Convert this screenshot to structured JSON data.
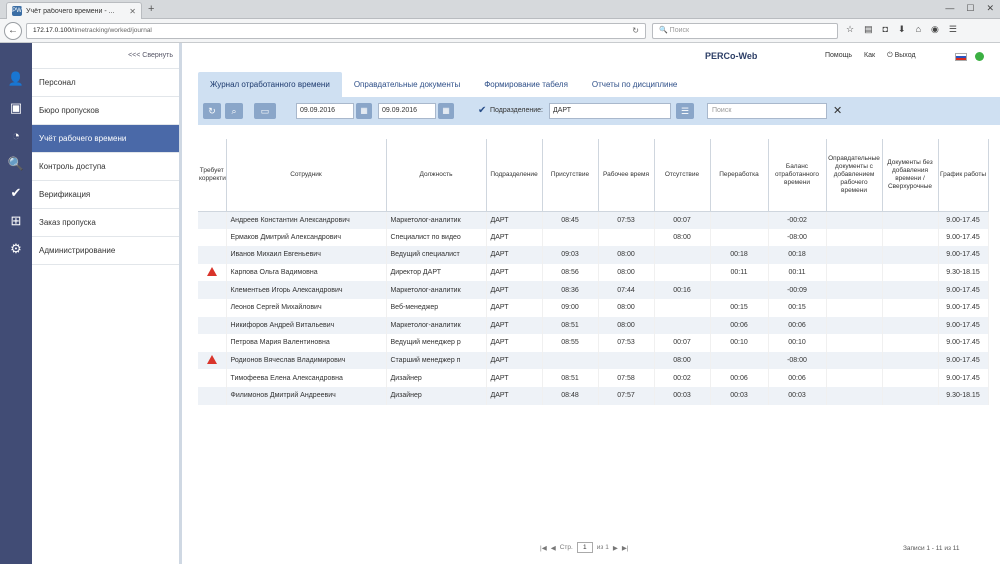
{
  "browser": {
    "tab_title": "Учёт рабочего времени - ...",
    "tab_favicon": "PW",
    "url_host": "172.17.0.100",
    "url_path": "/timetracking/worked/journal",
    "search_placeholder": "Поиск"
  },
  "side_menu": {
    "collapse_label": "<<< Свернуть",
    "items": [
      {
        "label": "Персонал",
        "icon": "person-icon"
      },
      {
        "label": "Бюро пропусков",
        "icon": "id-card-icon"
      },
      {
        "label": "Учёт рабочего времени",
        "icon": "clock-person-icon",
        "active": true
      },
      {
        "label": "Контроль доступа",
        "icon": "search-icon"
      },
      {
        "label": "Верификация",
        "icon": "verify-icon"
      },
      {
        "label": "Заказ пропуска",
        "icon": "add-card-icon"
      },
      {
        "label": "Администрирование",
        "icon": "gear-icon"
      }
    ]
  },
  "header": {
    "brand": "PERCo-Web",
    "help": "Помощь",
    "user": "Как",
    "logout": "Выход"
  },
  "tabs": [
    {
      "label": "Журнал отработанного времени",
      "active": true
    },
    {
      "label": "Оправдательные документы"
    },
    {
      "label": "Формирование табеля"
    },
    {
      "label": "Отчеты по дисциплине"
    }
  ],
  "toolbar": {
    "date_from": "09.09.2016",
    "date_to": "09.09.2016",
    "department_label": "Подразделение:",
    "department_value": "ДАРТ",
    "search_placeholder": "Поиск"
  },
  "table": {
    "columns": [
      "Требует корректировки",
      "Сотрудник",
      "Должность",
      "Подразделение",
      "Присутствие",
      "Рабочее время",
      "Отсутствие",
      "Переработка",
      "Баланс отработанного времени",
      "Оправдательные документы с добавлением рабочего времени",
      "Документы без добавления времени / Сверхурочные",
      "График работы"
    ],
    "rows": [
      {
        "warn": false,
        "name": "Андреев Константин Александрович",
        "position": "Маркетолог-аналитик",
        "dept": "ДАРТ",
        "presence": "08:45",
        "work": "07:53",
        "absence": "00:07",
        "overtime": "",
        "balance": "-00:02",
        "docs_add": "",
        "docs_no": "",
        "schedule": "9.00-17.45"
      },
      {
        "warn": false,
        "name": "Ермаков Дмитрий Александрович",
        "position": "Специалист по видео",
        "dept": "ДАРТ",
        "presence": "",
        "work": "",
        "absence": "08:00",
        "overtime": "",
        "balance": "-08:00",
        "docs_add": "",
        "docs_no": "",
        "schedule": "9.00-17.45"
      },
      {
        "warn": false,
        "name": "Иванов Михаил Евгеньевич",
        "position": "Ведущий специалист",
        "dept": "ДАРТ",
        "presence": "09:03",
        "work": "08:00",
        "absence": "",
        "overtime": "00:18",
        "balance": "00:18",
        "docs_add": "",
        "docs_no": "",
        "schedule": "9.00-17.45"
      },
      {
        "warn": true,
        "name": "Карпова Ольга Вадимовна",
        "position": "Директор ДАРТ",
        "dept": "ДАРТ",
        "presence": "08:56",
        "work": "08:00",
        "absence": "",
        "overtime": "00:11",
        "balance": "00:11",
        "docs_add": "",
        "docs_no": "",
        "schedule": "9.30-18.15"
      },
      {
        "warn": false,
        "name": "Клементьев Игорь Александрович",
        "position": "Маркетолог-аналитик",
        "dept": "ДАРТ",
        "presence": "08:36",
        "work": "07:44",
        "absence": "00:16",
        "overtime": "",
        "balance": "-00:09",
        "docs_add": "",
        "docs_no": "",
        "schedule": "9.00-17.45"
      },
      {
        "warn": false,
        "name": "Леонов Сергей Михайлович",
        "position": "Веб-менеджер",
        "dept": "ДАРТ",
        "presence": "09:00",
        "work": "08:00",
        "absence": "",
        "overtime": "00:15",
        "balance": "00:15",
        "docs_add": "",
        "docs_no": "",
        "schedule": "9.00-17.45"
      },
      {
        "warn": false,
        "name": "Никифоров Андрей Витальевич",
        "position": "Маркетолог-аналитик",
        "dept": "ДАРТ",
        "presence": "08:51",
        "work": "08:00",
        "absence": "",
        "overtime": "00:06",
        "balance": "00:06",
        "docs_add": "",
        "docs_no": "",
        "schedule": "9.00-17.45"
      },
      {
        "warn": false,
        "name": "Петрова Мария Валентиновна",
        "position": "Ведущий менеджер р",
        "dept": "ДАРТ",
        "presence": "08:55",
        "work": "07:53",
        "absence": "00:07",
        "overtime": "00:10",
        "balance": "00:10",
        "docs_add": "",
        "docs_no": "",
        "schedule": "9.00-17.45"
      },
      {
        "warn": true,
        "name": "Родионов Вячеслав Владимирович",
        "position": "Старший менеджер п",
        "dept": "ДАРТ",
        "presence": "",
        "work": "",
        "absence": "08:00",
        "overtime": "",
        "balance": "-08:00",
        "docs_add": "",
        "docs_no": "",
        "schedule": "9.00-17.45"
      },
      {
        "warn": false,
        "name": "Тимофеева Елена Александровна",
        "position": "Дизайнер",
        "dept": "ДАРТ",
        "presence": "08:51",
        "work": "07:58",
        "absence": "00:02",
        "overtime": "00:06",
        "balance": "00:06",
        "docs_add": "",
        "docs_no": "",
        "schedule": "9.00-17.45"
      },
      {
        "warn": false,
        "name": "Филимонов Дмитрий Андреевич",
        "position": "Дизайнер",
        "dept": "ДАРТ",
        "presence": "08:48",
        "work": "07:57",
        "absence": "00:03",
        "overtime": "00:03",
        "balance": "00:03",
        "docs_add": "",
        "docs_no": "",
        "schedule": "9.30-18.15"
      }
    ]
  },
  "pager": {
    "page_label": "Стр.",
    "page": "1",
    "of": "из 1"
  },
  "records_count": "Записи 1 - 11 из 11",
  "colors": {
    "rail": "#414c75",
    "active_menu": "#4a69a8",
    "toolbar": "#cfe0f2",
    "warning": "#d9342b",
    "status_ok": "#3cb043"
  }
}
